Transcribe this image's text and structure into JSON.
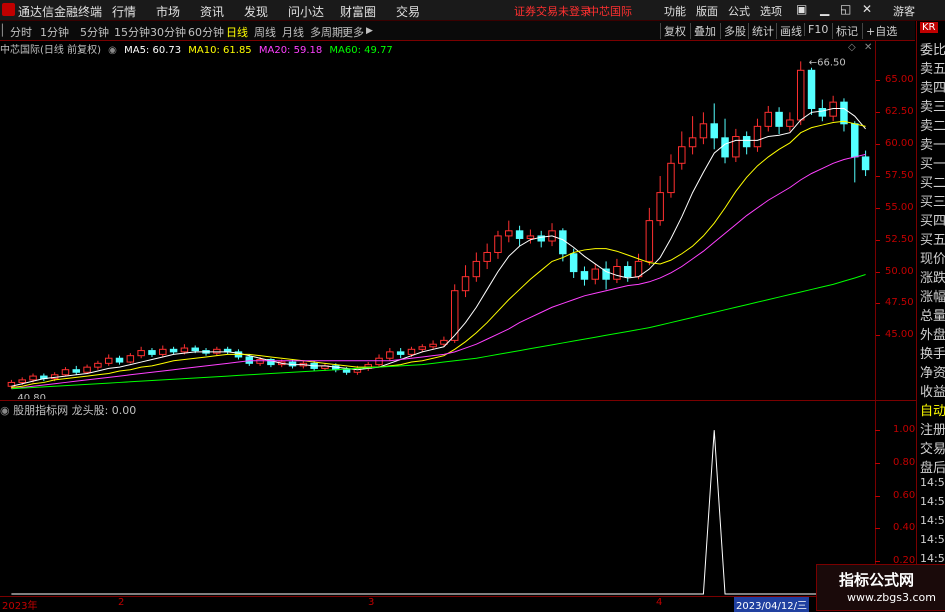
{
  "window": {
    "app_name": "通达信金融终端",
    "login_status": "证券交易未登录",
    "current_stock": "中芯国际",
    "guest": "游客"
  },
  "menubar": {
    "items": [
      "行情",
      "市场",
      "资讯",
      "发现",
      "问小达",
      "财富圈",
      "交易"
    ],
    "right_items": [
      "功能",
      "版面",
      "公式",
      "选项"
    ]
  },
  "toolbar": {
    "periods": [
      "分时",
      "1分钟",
      "5分钟",
      "15分钟",
      "30分钟",
      "60分钟",
      "日线",
      "周线",
      "月线",
      "多周期",
      "更多"
    ],
    "active_period": "日线",
    "buttons": [
      "复权",
      "叠加",
      "多股",
      "统计",
      "画线",
      "F10",
      "标记",
      "+自选"
    ]
  },
  "chart_header": {
    "title": "中芯国际(日线 前复权)",
    "ma5": "MA5: 60.73",
    "ma10": "MA10: 61.85",
    "ma20": "MA20: 59.18",
    "ma60": "MA60: 49.77"
  },
  "colors": {
    "ma5": "#ffffff",
    "ma10": "#ffff00",
    "ma20": "#ff40ff",
    "ma60": "#00ff00",
    "up": "#ff3030",
    "down": "#54ffff"
  },
  "indicator": {
    "title": "股朋指标网 龙头股: 0.00"
  },
  "right_panel": {
    "top": "KR",
    "items": [
      "委比",
      "卖五",
      "卖四",
      "卖三",
      "卖二",
      "卖一",
      "买一",
      "买二",
      "买三",
      "买四",
      "买五",
      "现价",
      "涨跌",
      "涨幅",
      "总量",
      "外盘",
      "换手",
      "净资",
      "收益",
      "自动",
      "注册",
      "交易",
      "盘后",
      "14:56",
      "14:56",
      "14:56",
      "14:56",
      "14:56",
      "14:56"
    ]
  },
  "time_axis": {
    "labels": [
      "2023年",
      "2",
      "3",
      "4",
      "2023/04/12/三"
    ]
  },
  "watermark": {
    "title": "指标公式网",
    "url": "www.zbgs3.com"
  },
  "chart_data": [
    {
      "type": "candlestick",
      "title": "中芯国际(日线 前复权)",
      "y_ticks": [
        45.0,
        47.5,
        50.0,
        52.5,
        55.0,
        57.5,
        60.0,
        62.5,
        65.0
      ],
      "ylim": [
        40.0,
        67.0
      ],
      "annotations": [
        {
          "label": "66.50",
          "value": 66.5
        },
        {
          "label": "40.80",
          "value": 40.8
        }
      ],
      "candles": [
        [
          41.0,
          41.3,
          40.8,
          41.5
        ],
        [
          41.3,
          41.5,
          41.1,
          41.7
        ],
        [
          41.5,
          41.8,
          41.3,
          42.0
        ],
        [
          41.8,
          41.6,
          41.4,
          42.0
        ],
        [
          41.6,
          41.9,
          41.4,
          42.1
        ],
        [
          41.9,
          42.3,
          41.8,
          42.5
        ],
        [
          42.3,
          42.1,
          41.9,
          42.6
        ],
        [
          42.1,
          42.5,
          42.0,
          42.7
        ],
        [
          42.5,
          42.8,
          42.3,
          43.0
        ],
        [
          42.8,
          43.2,
          42.6,
          43.5
        ],
        [
          43.2,
          42.9,
          42.7,
          43.4
        ],
        [
          42.9,
          43.4,
          42.8,
          43.6
        ],
        [
          43.4,
          43.8,
          43.2,
          44.1
        ],
        [
          43.8,
          43.5,
          43.3,
          44.0
        ],
        [
          43.5,
          43.9,
          43.3,
          44.2
        ],
        [
          43.9,
          43.7,
          43.5,
          44.1
        ],
        [
          43.7,
          44.0,
          43.5,
          44.3
        ],
        [
          44.0,
          43.8,
          43.6,
          44.2
        ],
        [
          43.8,
          43.6,
          43.4,
          44.0
        ],
        [
          43.6,
          43.9,
          43.4,
          44.1
        ],
        [
          43.9,
          43.7,
          43.5,
          44.1
        ],
        [
          43.7,
          43.3,
          43.1,
          43.9
        ],
        [
          43.3,
          42.8,
          42.6,
          43.5
        ],
        [
          42.8,
          43.1,
          42.6,
          43.3
        ],
        [
          43.1,
          42.7,
          42.5,
          43.2
        ],
        [
          42.7,
          42.9,
          42.5,
          43.1
        ],
        [
          42.9,
          42.6,
          42.4,
          43.1
        ],
        [
          42.6,
          42.8,
          42.4,
          43.0
        ],
        [
          42.8,
          42.4,
          42.2,
          43.0
        ],
        [
          42.4,
          42.6,
          42.2,
          42.8
        ],
        [
          42.6,
          42.3,
          42.1,
          42.8
        ],
        [
          42.3,
          42.1,
          41.9,
          42.5
        ],
        [
          42.1,
          42.4,
          41.9,
          42.6
        ],
        [
          42.4,
          42.7,
          42.2,
          42.9
        ],
        [
          42.7,
          43.2,
          42.5,
          43.5
        ],
        [
          43.2,
          43.7,
          43.0,
          44.0
        ],
        [
          43.7,
          43.5,
          43.2,
          44.0
        ],
        [
          43.5,
          43.9,
          43.3,
          44.1
        ],
        [
          43.9,
          44.1,
          43.7,
          44.3
        ],
        [
          44.1,
          44.3,
          43.9,
          44.6
        ],
        [
          44.3,
          44.6,
          44.1,
          44.9
        ],
        [
          44.6,
          48.5,
          44.4,
          49.0
        ],
        [
          48.5,
          49.6,
          48.0,
          50.5
        ],
        [
          49.6,
          50.8,
          49.2,
          51.5
        ],
        [
          50.8,
          51.5,
          50.2,
          52.2
        ],
        [
          51.5,
          52.8,
          51.0,
          53.2
        ],
        [
          52.8,
          53.2,
          52.3,
          54.0
        ],
        [
          53.2,
          52.6,
          52.0,
          53.6
        ],
        [
          52.6,
          52.8,
          52.2,
          53.3
        ],
        [
          52.8,
          52.4,
          51.9,
          53.2
        ],
        [
          52.4,
          53.2,
          52.0,
          53.8
        ],
        [
          53.2,
          51.4,
          50.8,
          53.4
        ],
        [
          51.4,
          50.0,
          49.5,
          51.8
        ],
        [
          50.0,
          49.4,
          48.9,
          50.4
        ],
        [
          49.4,
          50.2,
          49.0,
          50.6
        ],
        [
          50.2,
          49.4,
          48.6,
          50.8
        ],
        [
          49.4,
          50.4,
          49.1,
          51.0
        ],
        [
          50.4,
          49.6,
          49.2,
          50.8
        ],
        [
          49.6,
          50.8,
          49.4,
          51.4
        ],
        [
          50.8,
          54.0,
          50.5,
          55.0
        ],
        [
          54.0,
          56.2,
          53.6,
          57.5
        ],
        [
          56.2,
          58.5,
          55.8,
          59.2
        ],
        [
          58.5,
          59.8,
          58.0,
          61.0
        ],
        [
          59.8,
          60.5,
          59.2,
          62.2
        ],
        [
          60.5,
          61.6,
          60.0,
          62.5
        ],
        [
          61.6,
          60.5,
          59.6,
          63.2
        ],
        [
          60.5,
          59.0,
          58.5,
          62.0
        ],
        [
          59.0,
          60.6,
          58.6,
          61.2
        ],
        [
          60.6,
          59.8,
          59.2,
          61.0
        ],
        [
          59.8,
          61.4,
          59.4,
          62.0
        ],
        [
          61.4,
          62.5,
          61.0,
          63.0
        ],
        [
          62.5,
          61.4,
          60.8,
          62.9
        ],
        [
          61.4,
          61.9,
          61.0,
          62.5
        ],
        [
          61.9,
          65.8,
          61.5,
          66.5
        ],
        [
          65.8,
          62.8,
          62.3,
          66.0
        ],
        [
          62.8,
          62.2,
          61.8,
          63.5
        ],
        [
          62.2,
          63.3,
          61.8,
          63.8
        ],
        [
          63.3,
          61.6,
          61.0,
          63.6
        ],
        [
          61.6,
          59.0,
          57.0,
          61.8
        ],
        [
          59.0,
          58.0,
          57.5,
          59.5
        ]
      ],
      "series": [
        {
          "name": "MA5",
          "values": [
            41.0,
            41.2,
            41.4,
            41.6,
            41.7,
            41.8,
            41.9,
            42.0,
            42.2,
            42.4,
            42.5,
            42.7,
            42.9,
            43.1,
            43.3,
            43.5,
            43.6,
            43.7,
            43.7,
            43.7,
            43.7,
            43.6,
            43.4,
            43.2,
            43.0,
            42.8,
            42.7,
            42.7,
            42.6,
            42.6,
            42.5,
            42.4,
            42.3,
            42.4,
            42.5,
            42.8,
            43.1,
            43.4,
            43.7,
            43.9,
            44.1,
            45.0,
            46.0,
            47.2,
            48.6,
            50.0,
            51.2,
            52.0,
            52.5,
            52.7,
            52.8,
            52.5,
            51.9,
            51.2,
            50.6,
            50.0,
            49.7,
            49.5,
            49.6,
            50.2,
            51.1,
            52.6,
            54.3,
            56.2,
            57.8,
            59.3,
            60.0,
            60.3,
            60.3,
            60.3,
            60.6,
            60.7,
            60.9,
            61.9,
            62.5,
            62.6,
            62.8,
            62.8,
            62.2,
            61.2
          ]
        },
        {
          "name": "MA10",
          "values": [
            40.9,
            41.0,
            41.2,
            41.3,
            41.5,
            41.6,
            41.7,
            41.8,
            41.9,
            42.0,
            42.2,
            42.3,
            42.5,
            42.6,
            42.8,
            43.0,
            43.1,
            43.2,
            43.3,
            43.4,
            43.5,
            43.5,
            43.5,
            43.4,
            43.3,
            43.2,
            43.1,
            43.0,
            42.9,
            42.8,
            42.7,
            42.6,
            42.5,
            42.5,
            42.5,
            42.6,
            42.7,
            42.9,
            43.0,
            43.2,
            43.4,
            43.9,
            44.5,
            45.2,
            46.0,
            46.9,
            47.8,
            48.6,
            49.4,
            50.1,
            50.8,
            51.1,
            51.5,
            51.7,
            51.8,
            51.8,
            51.6,
            51.3,
            51.0,
            50.7,
            50.6,
            50.9,
            51.4,
            52.0,
            52.8,
            53.8,
            55.0,
            56.3,
            57.4,
            58.3,
            59.0,
            59.6,
            60.1,
            60.9,
            61.3,
            61.5,
            61.7,
            61.8,
            61.6,
            61.4
          ]
        },
        {
          "name": "MA20",
          "values": [
            40.8,
            40.9,
            41.0,
            41.1,
            41.2,
            41.3,
            41.4,
            41.5,
            41.6,
            41.7,
            41.8,
            41.9,
            42.0,
            42.1,
            42.2,
            42.3,
            42.4,
            42.5,
            42.6,
            42.7,
            42.8,
            42.9,
            43.0,
            43.0,
            43.0,
            43.0,
            43.0,
            43.0,
            43.0,
            43.0,
            43.0,
            43.0,
            43.0,
            43.0,
            43.0,
            43.0,
            43.1,
            43.2,
            43.3,
            43.4,
            43.5,
            43.7,
            44.0,
            44.3,
            44.7,
            45.1,
            45.5,
            46.0,
            46.4,
            46.8,
            47.2,
            47.5,
            47.8,
            48.1,
            48.3,
            48.5,
            48.7,
            48.9,
            49.0,
            49.2,
            49.5,
            49.9,
            50.4,
            51.0,
            51.6,
            52.3,
            53.0,
            53.7,
            54.4,
            55.0,
            55.6,
            56.1,
            56.6,
            57.2,
            57.7,
            58.1,
            58.5,
            58.8,
            59.0,
            59.2
          ]
        },
        {
          "name": "MA60",
          "values": [
            40.8,
            40.85,
            40.9,
            40.95,
            41.0,
            41.05,
            41.1,
            41.15,
            41.2,
            41.25,
            41.3,
            41.35,
            41.4,
            41.45,
            41.5,
            41.55,
            41.6,
            41.65,
            41.7,
            41.75,
            41.8,
            41.85,
            41.9,
            41.95,
            42.0,
            42.05,
            42.1,
            42.15,
            42.2,
            42.25,
            42.3,
            42.35,
            42.4,
            42.45,
            42.5,
            42.55,
            42.6,
            42.65,
            42.7,
            42.8,
            42.9,
            43.0,
            43.1,
            43.2,
            43.35,
            43.5,
            43.65,
            43.8,
            43.95,
            44.1,
            44.25,
            44.4,
            44.55,
            44.7,
            44.85,
            45.0,
            45.15,
            45.3,
            45.45,
            45.6,
            45.8,
            46.0,
            46.2,
            46.4,
            46.6,
            46.8,
            47.0,
            47.2,
            47.4,
            47.6,
            47.8,
            48.0,
            48.2,
            48.4,
            48.6,
            48.8,
            49.0,
            49.25,
            49.5,
            49.77
          ]
        }
      ]
    },
    {
      "type": "line",
      "title": "股朋指标网 龙头股: 0.00",
      "y_ticks": [
        0.0,
        0.2,
        0.4,
        0.6,
        0.8,
        1.0
      ],
      "ylim": [
        0,
        1.05
      ],
      "series": [
        {
          "name": "龙头股",
          "values": [
            0,
            0,
            0,
            0,
            0,
            0,
            0,
            0,
            0,
            0,
            0,
            0,
            0,
            0,
            0,
            0,
            0,
            0,
            0,
            0,
            0,
            0,
            0,
            0,
            0,
            0,
            0,
            0,
            0,
            0,
            0,
            0,
            0,
            0,
            0,
            0,
            0,
            0,
            0,
            0,
            0,
            0,
            0,
            0,
            0,
            0,
            0,
            0,
            0,
            0,
            0,
            0,
            0,
            0,
            0,
            0,
            0,
            0,
            0,
            0,
            0,
            0,
            0,
            0,
            0,
            1,
            0,
            0,
            0,
            0,
            0,
            0,
            0,
            0,
            0,
            0,
            0,
            0,
            0,
            0
          ]
        }
      ]
    }
  ]
}
